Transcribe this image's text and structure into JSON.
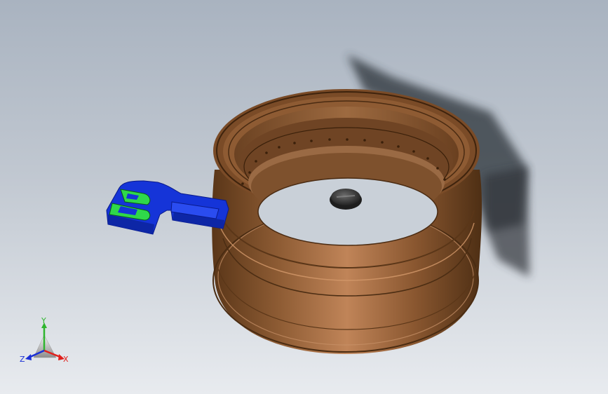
{
  "viewport": {
    "background_top": "#a9b3c0",
    "background_bottom": "#e8ebef"
  },
  "model": {
    "rim_color": "#8a5a33",
    "clip_color": "#1737e6",
    "clip_letter_color": "#2fd84a",
    "cap_color": "#3c3c3c"
  },
  "triad": {
    "x_label": "X",
    "y_label": "Y",
    "z_label": "Z",
    "x_color": "#e0201c",
    "y_color": "#2fb52f",
    "z_color": "#1a2fd6"
  }
}
